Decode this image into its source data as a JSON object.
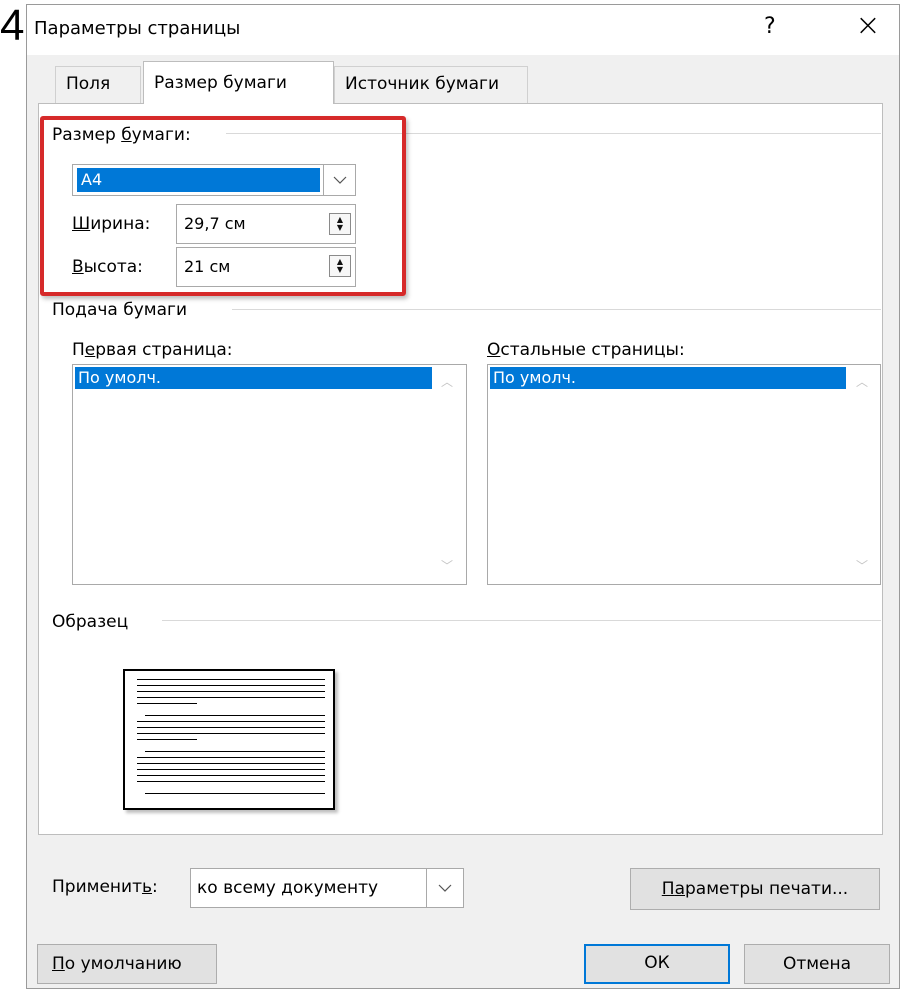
{
  "slide_number": "4",
  "window": {
    "title": "Параметры страницы",
    "help": "?",
    "close": "×"
  },
  "tabs": [
    "Поля",
    "Размер бумаги",
    "Источник бумаги"
  ],
  "paper_size": {
    "group": [
      "Размер ",
      "б",
      "умаги:"
    ],
    "selected": "A4",
    "width_label": [
      "Ш",
      "ирина:"
    ],
    "width_value": "29,7 см",
    "height_label": [
      "В",
      "ысота:"
    ],
    "height_value": "21 см"
  },
  "paper_source": {
    "group": "Подача бумаги",
    "first_label": [
      "П",
      "е",
      "рвая страница:"
    ],
    "first_selected": "По умолч.",
    "other_label": [
      "О",
      "стальные страницы:"
    ],
    "other_selected": "По умолч."
  },
  "preview": {
    "group": "Образец"
  },
  "apply": {
    "label": [
      "Применит",
      "ь",
      ":"
    ],
    "value": "ко всему документу"
  },
  "buttons": {
    "print_options": [
      "П",
      "а",
      "раметры печати..."
    ],
    "default": [
      "П",
      "о умолчанию"
    ],
    "ok": "ОК",
    "cancel": "Отмена"
  }
}
